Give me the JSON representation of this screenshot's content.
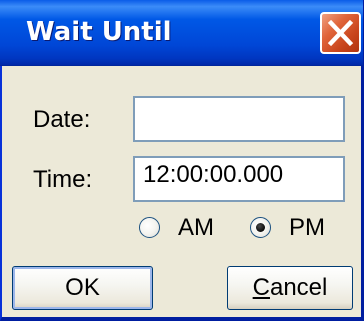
{
  "window": {
    "title": "Wait Until"
  },
  "form": {
    "date_label": "Date:",
    "date_value": "",
    "time_label": "Time:",
    "time_value": "12:00:00.000",
    "am_label": "AM",
    "pm_label": "PM",
    "selected_period": "PM"
  },
  "buttons": {
    "ok_label": "OK",
    "cancel_mnemonic": "C",
    "cancel_rest": "ancel"
  },
  "icons": {
    "close": "close-icon",
    "radio": "radio-button"
  },
  "colors": {
    "titlebar": "#0054e3",
    "window_bg": "#ece9d8",
    "close_button": "#e0653a",
    "field_border": "#7f9db9"
  }
}
